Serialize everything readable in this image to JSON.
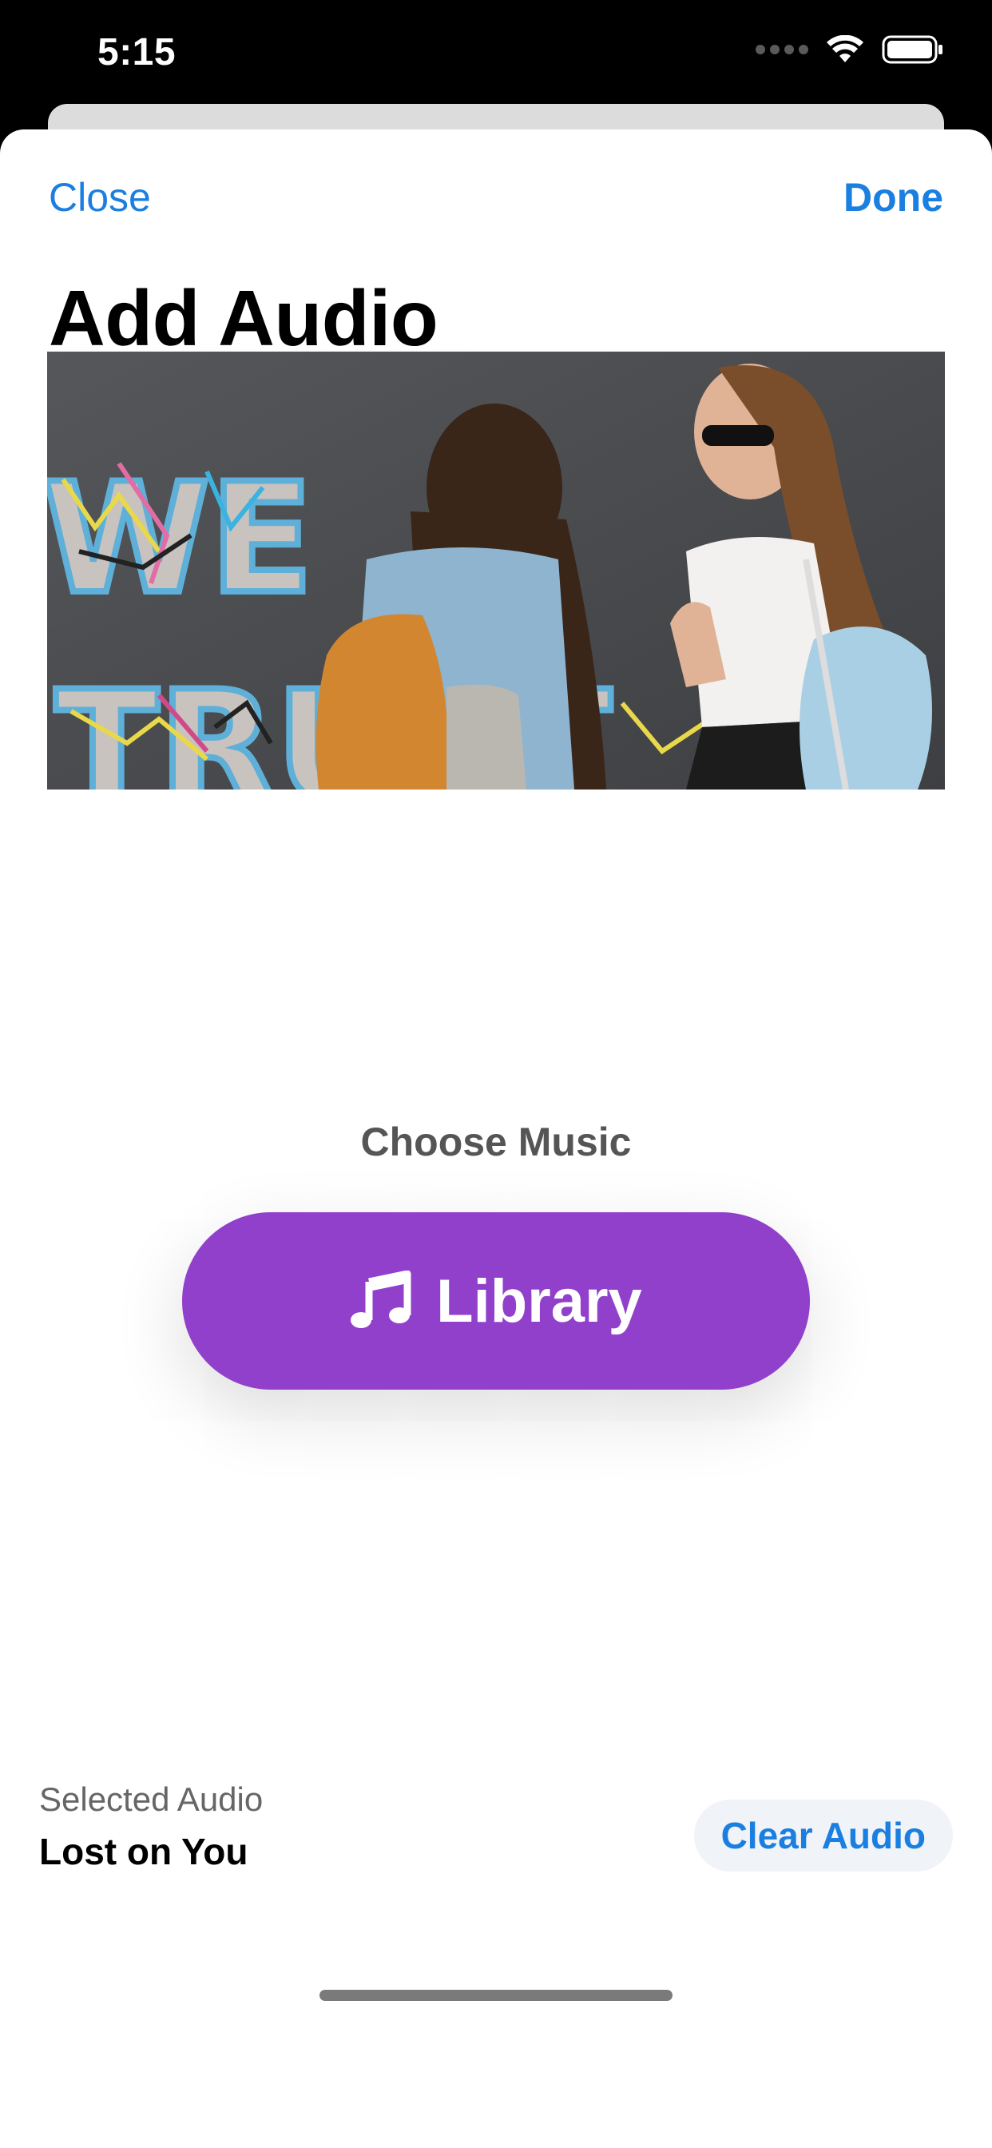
{
  "status_bar": {
    "time": "5:15",
    "signal_icon": "signal-dots-icon",
    "wifi_icon": "wifi-icon",
    "battery_icon": "battery-icon"
  },
  "nav": {
    "close_label": "Close",
    "done_label": "Done"
  },
  "page": {
    "title": "Add Audio"
  },
  "media": {
    "preview_graffiti_text": "WE TRUST"
  },
  "music": {
    "choose_label": "Choose Music",
    "library_label": "Library",
    "library_icon": "music-note-icon"
  },
  "selection": {
    "caption": "Selected Audio",
    "value": "Lost on You",
    "clear_label": "Clear Audio"
  },
  "colors": {
    "accent_blue": "#1a7fe0",
    "library_purple": "#9140cc",
    "clear_button_bg": "#f0f3f7"
  }
}
